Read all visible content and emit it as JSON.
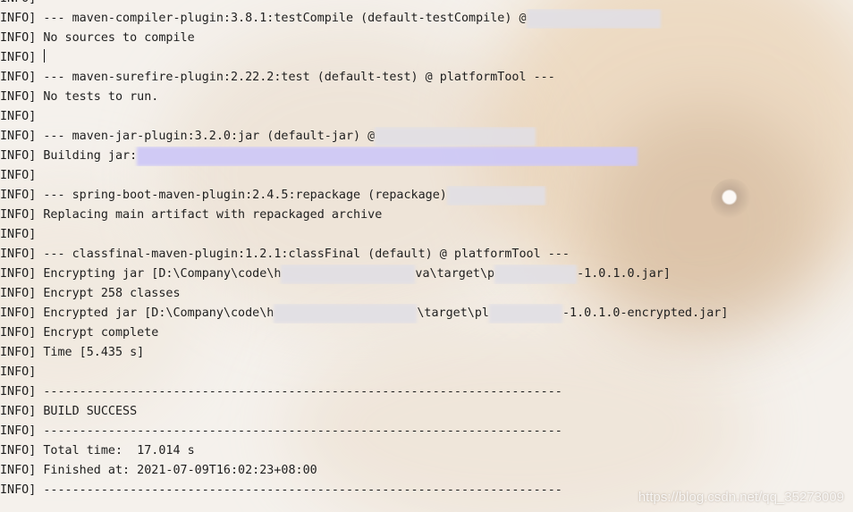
{
  "console": {
    "lines": [
      {
        "level": "INFO]",
        "text": "",
        "segments": []
      },
      {
        "level": "INFO]",
        "segments": [
          {
            "t": " --- maven-compiler-plugin:3.8.1:testCompile (default-testCompile) @"
          },
          {
            "r": 150
          }
        ]
      },
      {
        "level": "INFO]",
        "segments": [
          {
            "t": " No sources to compile"
          }
        ]
      },
      {
        "level": "INFO]",
        "segments": [
          {
            "t": " "
          },
          {
            "caret": true
          }
        ]
      },
      {
        "level": "INFO]",
        "segments": [
          {
            "t": " --- maven-surefire-plugin:2.22.2:test (default-test) @ platformTool ---"
          }
        ]
      },
      {
        "level": "INFO]",
        "segments": [
          {
            "t": " No tests to run."
          }
        ]
      },
      {
        "level": "INFO]",
        "segments": []
      },
      {
        "level": "INFO]",
        "segments": [
          {
            "t": " --- maven-jar-plugin:3.2.0:jar (default-jar) @"
          },
          {
            "r": 180
          }
        ]
      },
      {
        "level": "INFO]",
        "segments": [
          {
            "t": " Building jar:"
          },
          {
            "r": 560,
            "purple": true
          }
        ]
      },
      {
        "level": "INFO]",
        "segments": []
      },
      {
        "level": "INFO]",
        "segments": [
          {
            "t": " --- spring-boot-maven-plugin:2.4.5:repackage (repackage)"
          },
          {
            "r": 110
          }
        ]
      },
      {
        "level": "INFO]",
        "segments": [
          {
            "t": " Replacing main artifact with repackaged archive"
          }
        ]
      },
      {
        "level": "INFO]",
        "segments": []
      },
      {
        "level": "INFO]",
        "segments": [
          {
            "t": " --- classfinal-maven-plugin:1.2.1:classFinal (default) @ platformTool ---"
          }
        ]
      },
      {
        "level": "INFO]",
        "segments": [
          {
            "t": " Encrypting jar [D:\\Company\\code\\h"
          },
          {
            "r": 150
          },
          {
            "t": "va\\target\\p"
          },
          {
            "r": 92
          },
          {
            "t": "-1.0.1.0.jar]"
          }
        ]
      },
      {
        "level": "INFO]",
        "segments": [
          {
            "t": " Encrypt 258 classes"
          }
        ]
      },
      {
        "level": "INFO]",
        "segments": [
          {
            "t": " Encrypted jar [D:\\Company\\code\\h"
          },
          {
            "r": 160
          },
          {
            "t": "\\target\\pl"
          },
          {
            "r": 82
          },
          {
            "t": "-1.0.1.0-encrypted.jar]"
          }
        ]
      },
      {
        "level": "INFO]",
        "segments": [
          {
            "t": " Encrypt complete"
          }
        ]
      },
      {
        "level": "INFO]",
        "segments": [
          {
            "t": " Time [5.435 s]"
          }
        ]
      },
      {
        "level": "INFO]",
        "segments": []
      },
      {
        "level": "INFO]",
        "segments": [
          {
            "t": " ------------------------------------------------------------------------"
          }
        ]
      },
      {
        "level": "INFO]",
        "segments": [
          {
            "t": " BUILD SUCCESS"
          }
        ]
      },
      {
        "level": "INFO]",
        "segments": [
          {
            "t": " ------------------------------------------------------------------------"
          }
        ]
      },
      {
        "level": "INFO]",
        "segments": [
          {
            "t": " Total time:  17.014 s"
          }
        ]
      },
      {
        "level": "INFO]",
        "segments": [
          {
            "t": " Finished at: 2021-07-09T16:02:23+08:00"
          }
        ]
      },
      {
        "level": "INFO]",
        "segments": [
          {
            "t": " ------------------------------------------------------------------------"
          }
        ]
      }
    ]
  },
  "watermark": "https://blog.csdn.net/qq_35273009"
}
